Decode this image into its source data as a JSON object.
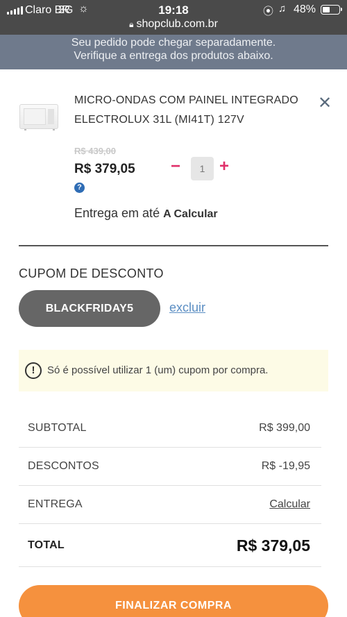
{
  "status_bar": {
    "carrier": "Claro BR",
    "network": "3G",
    "time": "19:18",
    "battery_percent": "48%",
    "battery_level": 0.48
  },
  "browser": {
    "url": "shopclub.com.br"
  },
  "notice": {
    "line1": "Seu pedido pode chegar separadamente.",
    "line2": "Verifique a entrega dos produtos abaixo."
  },
  "product": {
    "name": "MICRO-ONDAS COM PAINEL INTEGRADO ELECTROLUX 31L (MI41T) 127V",
    "old_price": "R$ 439,00",
    "price": "R$ 379,05",
    "quantity": "1",
    "delivery_prefix": "Entrega em até",
    "delivery_value": "A Calcular"
  },
  "coupon": {
    "title": "CUPOM DE DESCONTO",
    "code": "BLACKFRIDAY5",
    "delete_label": "excluir",
    "warning": "Só é possível utilizar 1 (um) cupom por compra."
  },
  "summary": {
    "subtotal_label": "SUBTOTAL",
    "subtotal_value": "R$ 399,00",
    "discounts_label": "DESCONTOS",
    "discounts_value": "R$ -19,95",
    "shipping_label": "ENTREGA",
    "shipping_value": "Calcular",
    "total_label": "TOTAL",
    "total_value": "R$ 379,05"
  },
  "checkout_label": "FINALIZAR COMPRA",
  "colors": {
    "accent_pink": "#e0306a",
    "checkout_orange": "#f5913e",
    "coupon_gray": "#666666",
    "link_blue": "#5b8ec3",
    "notice_bg": "#6f7a8c"
  }
}
